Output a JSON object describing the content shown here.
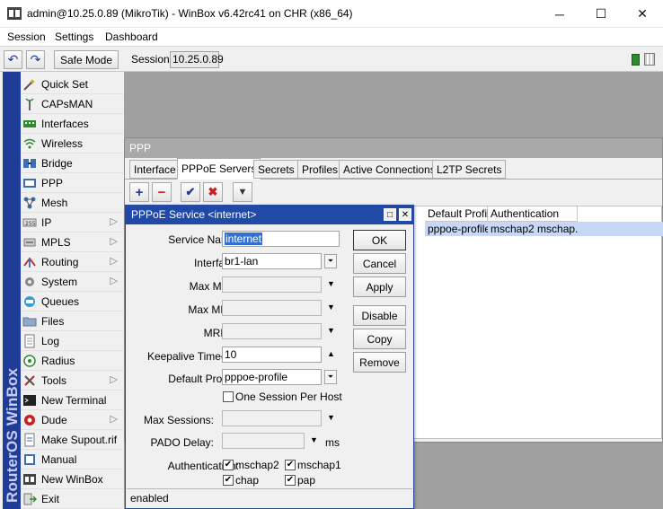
{
  "window": {
    "title": "admin@10.25.0.89 (MikroTik) - WinBox v6.42rc41 on CHR (x86_64)",
    "minimize_glyph": "─",
    "maximize_glyph": "☐",
    "close_glyph": "✕"
  },
  "menubar": {
    "items": [
      "Session",
      "Settings",
      "Dashboard"
    ]
  },
  "toolbar": {
    "undo_glyph": "↶",
    "redo_glyph": "↷",
    "safe_mode_label": "Safe Mode",
    "session_label": "Session:",
    "session_value": "10.25.0.89"
  },
  "sidebar": {
    "brand": "RouterOS WinBox",
    "items": [
      {
        "label": "Quick Set",
        "icon": "wand-icon",
        "has_submenu": false
      },
      {
        "label": "CAPsMAN",
        "icon": "antenna-icon",
        "has_submenu": false
      },
      {
        "label": "Interfaces",
        "icon": "interfaces-icon",
        "has_submenu": false
      },
      {
        "label": "Wireless",
        "icon": "wireless-icon",
        "has_submenu": false
      },
      {
        "label": "Bridge",
        "icon": "bridge-icon",
        "has_submenu": false
      },
      {
        "label": "PPP",
        "icon": "ppp-icon",
        "has_submenu": false
      },
      {
        "label": "Mesh",
        "icon": "mesh-icon",
        "has_submenu": false
      },
      {
        "label": "IP",
        "icon": "ip-icon",
        "has_submenu": true
      },
      {
        "label": "MPLS",
        "icon": "mpls-icon",
        "has_submenu": true
      },
      {
        "label": "Routing",
        "icon": "routing-icon",
        "has_submenu": true
      },
      {
        "label": "System",
        "icon": "gear-icon",
        "has_submenu": true
      },
      {
        "label": "Queues",
        "icon": "queues-icon",
        "has_submenu": false
      },
      {
        "label": "Files",
        "icon": "folder-icon",
        "has_submenu": false
      },
      {
        "label": "Log",
        "icon": "log-icon",
        "has_submenu": false
      },
      {
        "label": "Radius",
        "icon": "radius-icon",
        "has_submenu": false
      },
      {
        "label": "Tools",
        "icon": "tools-icon",
        "has_submenu": true
      },
      {
        "label": "New Terminal",
        "icon": "terminal-icon",
        "has_submenu": false
      },
      {
        "label": "Dude",
        "icon": "dude-icon",
        "has_submenu": true
      },
      {
        "label": "Make Supout.rif",
        "icon": "supout-icon",
        "has_submenu": false
      },
      {
        "label": "Manual",
        "icon": "manual-icon",
        "has_submenu": false
      },
      {
        "label": "New WinBox",
        "icon": "winbox-icon",
        "has_submenu": false
      },
      {
        "label": "Exit",
        "icon": "exit-icon",
        "has_submenu": false
      }
    ],
    "submenu_glyph": "▷"
  },
  "ppp_window": {
    "title": "PPP",
    "tabs": [
      "Interface",
      "PPPoE Servers",
      "Secrets",
      "Profiles",
      "Active Connections",
      "L2TP Secrets"
    ],
    "active_tab": "PPPoE Servers",
    "tool_glyphs": {
      "add": "+",
      "remove": "−",
      "enable": "✔",
      "disable": "✖",
      "filter": "▼"
    },
    "list": {
      "columns": [
        "Default Profile",
        "Authentication"
      ],
      "rows": [
        [
          "pppoe-profile",
          "mschap2 mschap..."
        ]
      ]
    }
  },
  "dialog": {
    "title": "PPPoE Service <internet>",
    "title_buttons": {
      "restore": "□",
      "close": "✕"
    },
    "fields": {
      "service_name": {
        "label": "Service Name:",
        "value": "internet"
      },
      "interface": {
        "label": "Interface:",
        "value": "br1-lan"
      },
      "max_mtu": {
        "label": "Max MTU:",
        "value": ""
      },
      "max_mru": {
        "label": "Max MRU:",
        "value": ""
      },
      "mrru": {
        "label": "MRRU:",
        "value": ""
      },
      "keepalive_timeout": {
        "label": "Keepalive Timeout:",
        "value": "10"
      },
      "default_profile": {
        "label": "Default Profile:",
        "value": "pppoe-profile"
      },
      "one_session_per_host": {
        "label": "One Session Per Host",
        "checked": false
      },
      "max_sessions": {
        "label": "Max Sessions:",
        "value": ""
      },
      "pado_delay": {
        "label": "PADO Delay:",
        "value": "",
        "unit": "ms"
      },
      "authentication": {
        "label": "Authentication:",
        "options": [
          {
            "label": "mschap2",
            "checked": true
          },
          {
            "label": "mschap1",
            "checked": true
          },
          {
            "label": "chap",
            "checked": true
          },
          {
            "label": "pap",
            "checked": true
          }
        ]
      }
    },
    "buttons": [
      "OK",
      "Cancel",
      "Apply",
      "Disable",
      "Copy",
      "Remove"
    ],
    "status": "enabled",
    "glyphs": {
      "dropdown": "▼",
      "spin_up": "▲",
      "check": "✔",
      "select_arrow": "⏷"
    }
  },
  "colors": {
    "brand_strip": "#1f3c98",
    "dialog_title": "#2149a8",
    "selection": "#c6d8f5",
    "workspace": "#a0a0a0"
  }
}
